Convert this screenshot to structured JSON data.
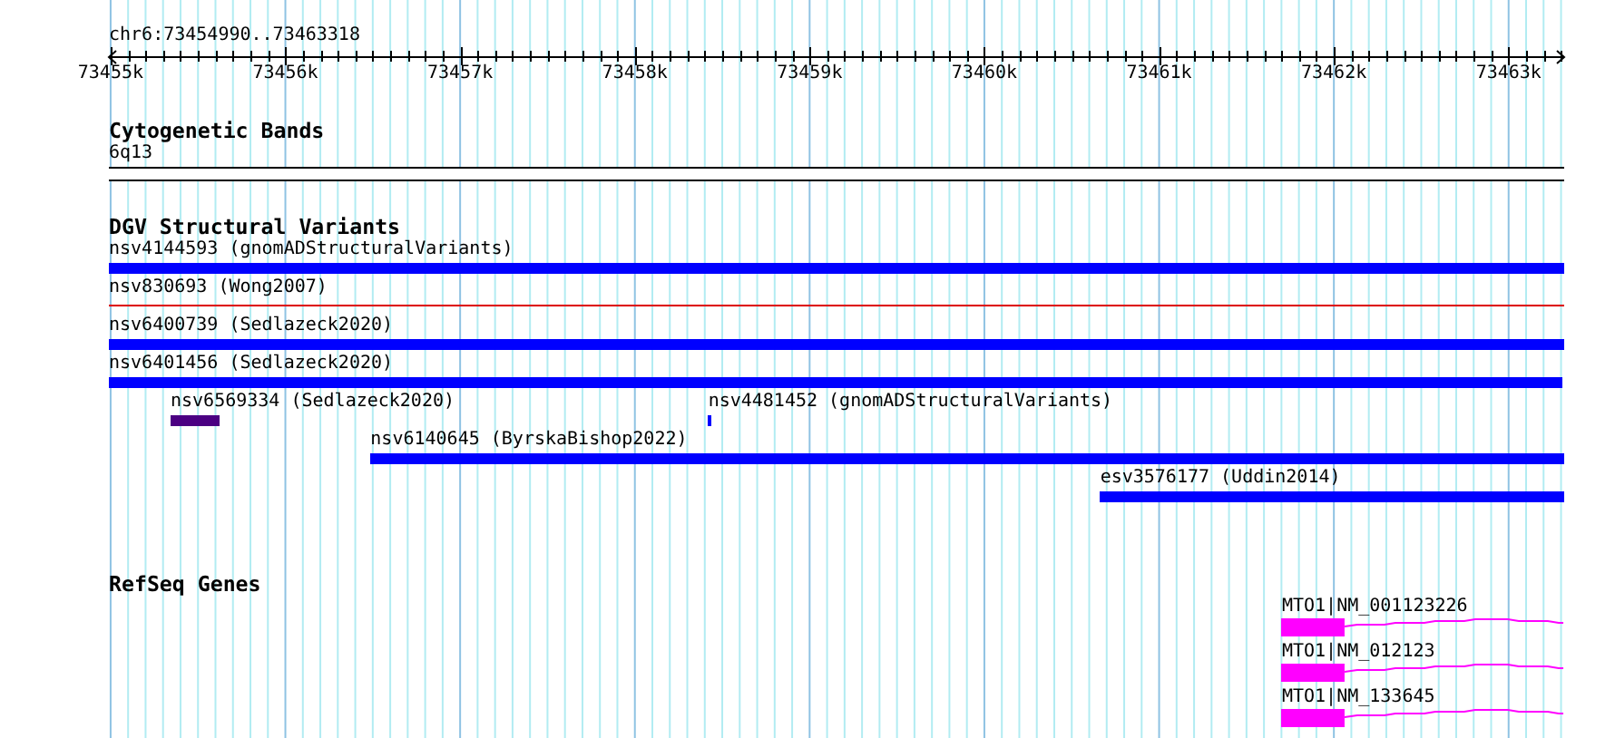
{
  "ruler": {
    "location": "chr6:73454990..73463318",
    "ticks": [
      "73455k",
      "73456k",
      "73457k",
      "73458k",
      "73459k",
      "73460k",
      "73461k",
      "73462k",
      "73463k"
    ]
  },
  "tracks": [
    {
      "title": "Cytogenetic Bands",
      "kind": "cytoband",
      "features": [
        {
          "label": "6q13"
        }
      ]
    },
    {
      "title": "DGV Structural Variants",
      "kind": "variants",
      "features": [
        {
          "label": "nsv4144593 (gnomADStructuralVariants)",
          "kind": "bar",
          "color": "#0000ff"
        },
        {
          "label": "nsv830693 (Wong2007)",
          "kind": "line",
          "color": "#dd0000"
        },
        {
          "label": "nsv6400739 (Sedlazeck2020)",
          "kind": "bar",
          "color": "#0000ff"
        },
        {
          "label": "nsv6401456 (Sedlazeck2020)",
          "kind": "bar",
          "color": "#0000ff"
        },
        {
          "label": "nsv6569334 (Sedlazeck2020)",
          "kind": "bar",
          "color": "#4b0082"
        },
        {
          "label": "nsv4481452 (gnomADStructuralVariants)",
          "kind": "bar",
          "color": "#0000ff"
        },
        {
          "label": "nsv6140645 (ByrskaBishop2022)",
          "kind": "bar",
          "color": "#0000ff"
        },
        {
          "label": "esv3576177 (Uddin2014)",
          "kind": "bar",
          "color": "#0000ff"
        }
      ]
    },
    {
      "title": "RefSeq Genes",
      "kind": "genes",
      "features": [
        {
          "label": "MTO1|NM_001123226"
        },
        {
          "label": "MTO1|NM_012123"
        },
        {
          "label": "MTO1|NM_133645"
        }
      ]
    }
  ]
}
